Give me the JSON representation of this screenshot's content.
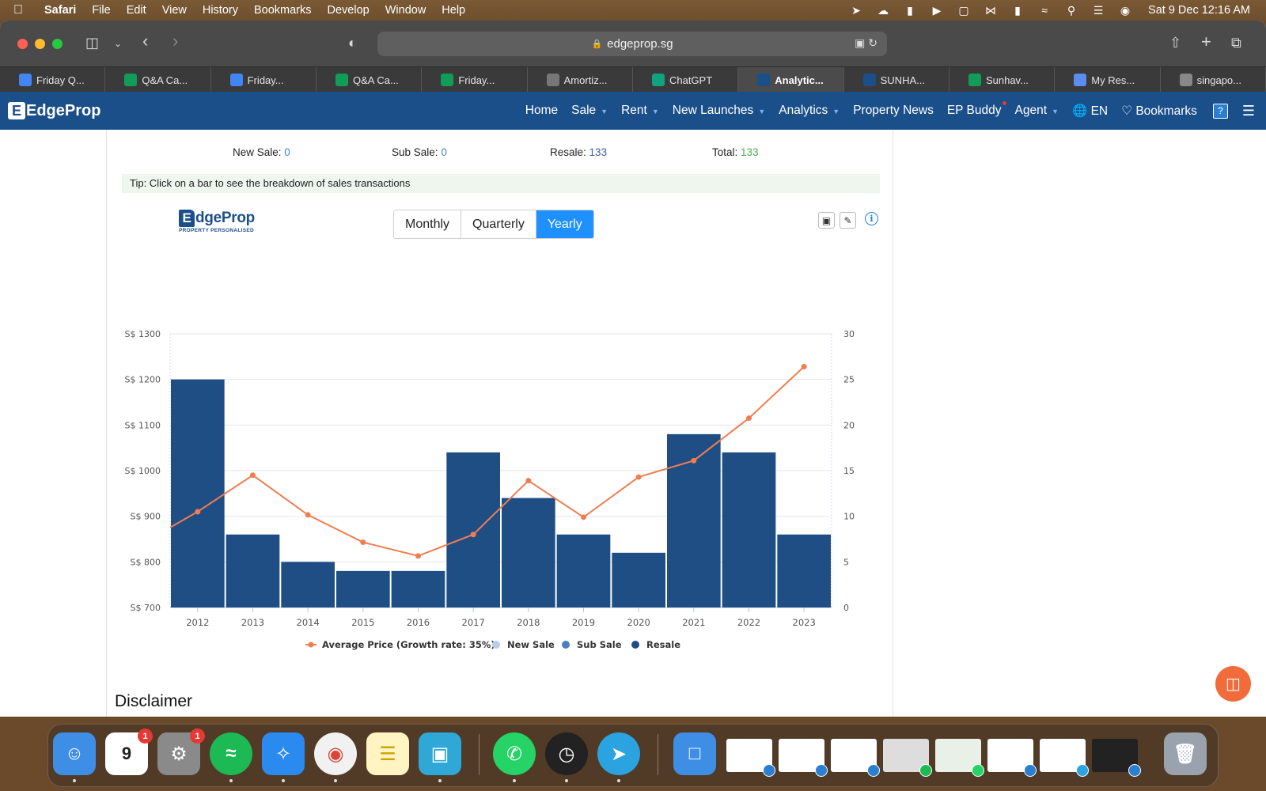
{
  "menubar": {
    "app": "Safari",
    "items": [
      "File",
      "Edit",
      "View",
      "History",
      "Bookmarks",
      "Develop",
      "Window",
      "Help"
    ],
    "clock": "Sat 9 Dec  12:16 AM"
  },
  "browser": {
    "url": "edgeprop.sg",
    "tabs": [
      {
        "label": "Friday Q...",
        "icon": "docs-icon",
        "color": "#4285f4"
      },
      {
        "label": "Q&A Ca...",
        "icon": "sheets-icon",
        "color": "#0f9d58"
      },
      {
        "label": "Friday...",
        "icon": "docs-icon",
        "color": "#4285f4"
      },
      {
        "label": "Q&A Ca...",
        "icon": "sheets-icon",
        "color": "#0f9d58"
      },
      {
        "label": "Friday...",
        "icon": "sheets-icon",
        "color": "#0f9d58"
      },
      {
        "label": "Amortiz...",
        "icon": "calculator-icon",
        "color": "#777777"
      },
      {
        "label": "ChatGPT",
        "icon": "chatgpt-icon",
        "color": "#10a37f"
      },
      {
        "label": "Analytic...",
        "icon": "edgeprop-icon",
        "color": "#1b4f8a"
      },
      {
        "label": "SUNHA...",
        "icon": "edgeprop-icon",
        "color": "#1b4f8a"
      },
      {
        "label": "Sunhav...",
        "icon": "arrow-icon",
        "color": "#0f9d58"
      },
      {
        "label": "My Res...",
        "icon": "shield-icon",
        "color": "#5b8def"
      },
      {
        "label": "singapo...",
        "icon": "google-icon",
        "color": "#888888"
      }
    ],
    "active_tab": 7
  },
  "site": {
    "logo": "EdgeProp",
    "nav": {
      "home": "Home",
      "sale": "Sale",
      "rent": "Rent",
      "new_launches": "New Launches",
      "analytics": "Analytics",
      "news": "Property News",
      "buddy": "EP Buddy",
      "agent": "Agent",
      "lang": "EN",
      "bookmarks": "Bookmarks"
    }
  },
  "summary": {
    "new_sale_label": "New Sale:",
    "new_sale_value": "0",
    "sub_sale_label": "Sub Sale:",
    "sub_sale_value": "0",
    "resale_label": "Resale:",
    "resale_value": "133",
    "total_label": "Total:",
    "total_value": "133"
  },
  "tip": "Tip: Click on a bar to see the breakdown of sales transactions",
  "chart_logo": {
    "main": "dgeProp",
    "letter": "E",
    "sub": "PROPERTY PERSONALISED"
  },
  "period": {
    "options": [
      "Monthly",
      "Quarterly",
      "Yearly"
    ],
    "selected": "Yearly"
  },
  "chart_data": {
    "type": "bar",
    "categories": [
      "2012",
      "2013",
      "2014",
      "2015",
      "2016",
      "2017",
      "2018",
      "2019",
      "2020",
      "2021",
      "2022",
      "2023"
    ],
    "series": [
      {
        "name": "Resale",
        "type": "bar",
        "axis": "right",
        "color": "#1f4e85",
        "values": [
          25,
          8,
          5,
          4,
          4,
          17,
          12,
          8,
          6,
          19,
          17,
          8
        ]
      },
      {
        "name": "Average Price (Growth rate: 35%)",
        "type": "line",
        "axis": "left",
        "color": "#f07d52",
        "values": [
          910,
          990,
          903,
          843,
          813,
          860,
          978,
          898,
          986,
          1022,
          1115,
          1228
        ]
      }
    ],
    "left_axis": {
      "min": 700,
      "max": 1300,
      "ticks": [
        "S$ 700",
        "S$ 800",
        "S$ 900",
        "S$ 1000",
        "S$ 1100",
        "S$ 1200",
        "S$ 1300"
      ]
    },
    "right_axis": {
      "min": 0,
      "max": 30,
      "ticks": [
        "0",
        "5",
        "10",
        "15",
        "20",
        "25",
        "30"
      ]
    },
    "legend": [
      {
        "label": "Average Price (Growth rate: 35%)",
        "color": "#f07d52",
        "marker": "line"
      },
      {
        "label": "New Sale",
        "color": "#b8cfe8",
        "marker": "dot"
      },
      {
        "label": "Sub Sale",
        "color": "#4a7fc0",
        "marker": "dot"
      },
      {
        "label": "Resale",
        "color": "#1f4e85",
        "marker": "dot"
      }
    ],
    "legend_position": "bottom",
    "grid": true
  },
  "disclaimer": "Disclaimer"
}
